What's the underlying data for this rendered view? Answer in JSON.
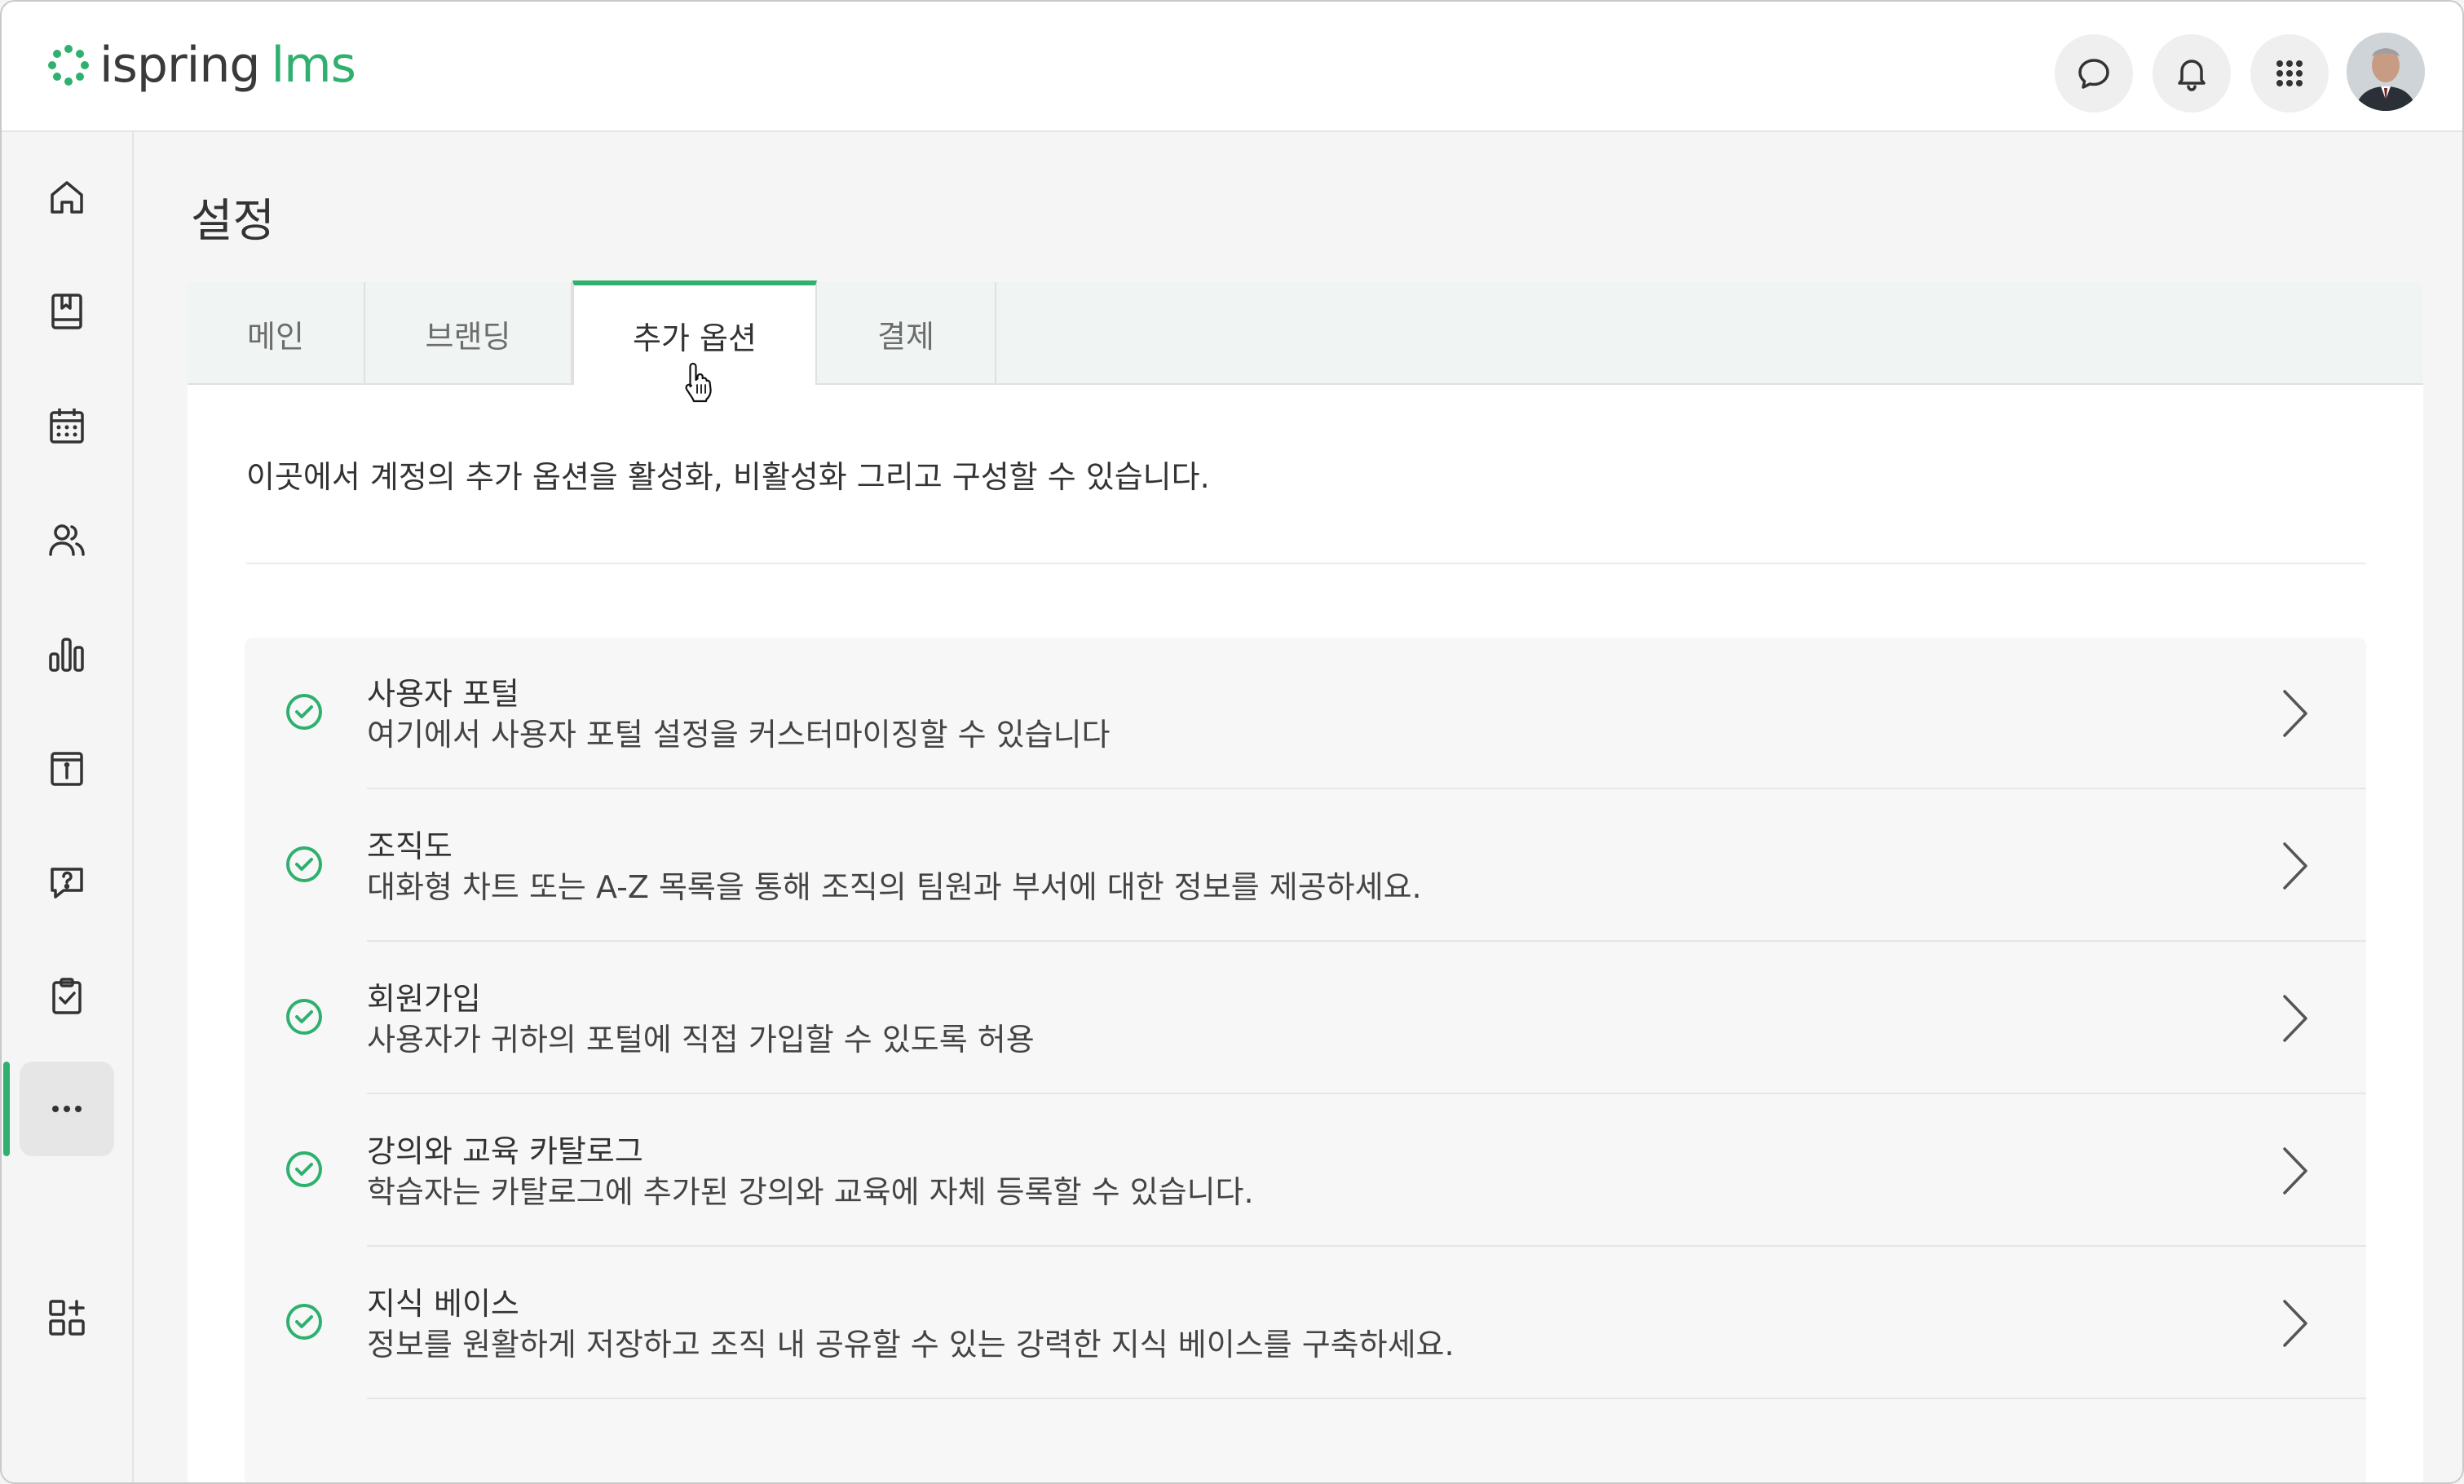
{
  "brand": {
    "name_part1": "ispring",
    "name_part2": "lms",
    "accent": "#2fb06e"
  },
  "header": {
    "icons": [
      "chat-icon",
      "bell-icon",
      "apps-grid-icon"
    ],
    "avatar": "user-avatar"
  },
  "sidebar": {
    "items": [
      {
        "icon": "home-icon"
      },
      {
        "icon": "book-icon"
      },
      {
        "icon": "calendar-icon"
      },
      {
        "icon": "users-icon"
      },
      {
        "icon": "reports-icon"
      },
      {
        "icon": "info-board-icon"
      },
      {
        "icon": "question-chat-icon"
      },
      {
        "icon": "clipboard-check-icon"
      },
      {
        "icon": "more-icon",
        "active": true
      },
      {
        "icon": "add-apps-icon"
      }
    ]
  },
  "page": {
    "title": "설정",
    "tabs": [
      {
        "label": "메인"
      },
      {
        "label": "브랜딩"
      },
      {
        "label": "추가 옵션",
        "active": true
      },
      {
        "label": "결제"
      }
    ],
    "intro": "이곳에서 계정의 추가 옵션을 활성화, 비활성화 그리고 구성할 수 있습니다.",
    "options": [
      {
        "title": "사용자 포털",
        "description": "여기에서 사용자 포털 설정을 커스터마이징할 수 있습니다",
        "enabled": true
      },
      {
        "title": "조직도",
        "description": "대화형 차트 또는 A-Z 목록을 통해 조직의 팀원과 부서에 대한 정보를 제공하세요.",
        "enabled": true
      },
      {
        "title": "회원가입",
        "description": "사용자가 귀하의 포털에 직접 가입할 수 있도록 허용",
        "enabled": true
      },
      {
        "title": "강의와 교육 카탈로그",
        "description": "학습자는 카탈로그에 추가된 강의와 교육에 자체 등록할 수 있습니다.",
        "enabled": true
      },
      {
        "title": "지식 베이스",
        "description": "정보를 원활하게 저장하고 조직 내 공유할 수 있는 강력한 지식 베이스를 구축하세요.",
        "enabled": true
      }
    ]
  }
}
